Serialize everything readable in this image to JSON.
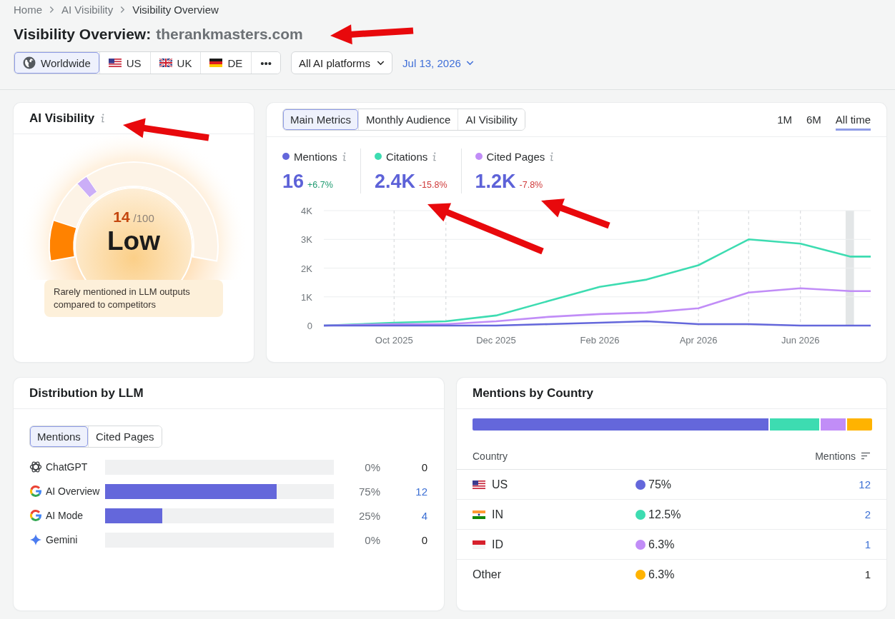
{
  "breadcrumb": [
    {
      "label": "Home",
      "current": false
    },
    {
      "label": "AI Visibility",
      "current": false
    },
    {
      "label": "Visibility Overview",
      "current": true
    }
  ],
  "page_title": {
    "heading": "Visibility Overview:",
    "domain": "therankmasters.com"
  },
  "filters": {
    "regions": [
      {
        "kind": "all",
        "label": "Worldwide",
        "selected": true
      },
      {
        "kind": "country",
        "label": "US",
        "selected": false
      },
      {
        "kind": "country",
        "label": "UK",
        "selected": false
      },
      {
        "kind": "country",
        "label": "DE",
        "selected": false
      },
      {
        "kind": "more",
        "label": "•••",
        "selected": false
      }
    ],
    "platform": "All AI platforms",
    "date": "Jul 13, 2026"
  },
  "visibility_card": {
    "title": "AI Visibility",
    "score": "14",
    "score_max": "/100",
    "rating": "Low",
    "level": 0.14,
    "benchmark": {
      "level": 0.31
    },
    "description": "Rarely mentioned in LLM outputs compared to competitors"
  },
  "metrics_panel": {
    "tabs": [
      {
        "label": "Main Metrics",
        "selected": true
      },
      {
        "label": "Monthly Audience",
        "selected": false
      },
      {
        "label": "AI Visibility",
        "selected": false
      }
    ],
    "ranges": [
      {
        "label": "1M",
        "selected": false
      },
      {
        "label": "6M",
        "selected": false
      },
      {
        "label": "All time",
        "selected": true
      }
    ],
    "metrics": [
      {
        "label": "Mentions",
        "color": "#6467db",
        "value": "16",
        "change": "+6.7%",
        "positive": true
      },
      {
        "label": "Citations",
        "color": "#3ddcb1",
        "value": "2.4K",
        "change": "-15.8%",
        "positive": false
      },
      {
        "label": "Cited Pages",
        "color": "#c18df7",
        "value": "1.2K",
        "change": "-7.8%",
        "positive": false
      }
    ],
    "chart_data": [
      {
        "type": "line",
        "x": [
          "2025-08-20",
          "2025-10-01",
          "2025-11-01",
          "2025-12-01",
          "2026-01-01",
          "2026-02-01",
          "2026-03-01",
          "2026-04-01",
          "2026-05-01",
          "2026-06-01",
          "2026-07-01",
          "2026-07-13"
        ],
        "series": [
          {
            "color": "#3ddcb1",
            "values": [
              0,
              100,
              150,
              350,
              850,
              1350,
              1600,
              2100,
              3000,
              2850,
              2400,
              2400
            ]
          },
          {
            "color": "#c18df7",
            "values": [
              0,
              50,
              50,
              150,
              300,
              400,
              450,
              600,
              1150,
              1300,
              1200,
              1200
            ]
          },
          {
            "color": "#6467db",
            "values": [
              0,
              0,
              0,
              0,
              50,
              100,
              150,
              50,
              50,
              0,
              0,
              0
            ]
          }
        ],
        "xlim": [
          "2025-08-20",
          "2026-07-13"
        ],
        "ylim": [
          0,
          4000
        ],
        "yticks": [
          {
            "value": 0,
            "label": "0"
          },
          {
            "value": 1000,
            "label": "1K"
          },
          {
            "value": 2000,
            "label": "2K"
          },
          {
            "value": 3000,
            "label": "3K"
          },
          {
            "value": 4000,
            "label": "4K"
          }
        ],
        "xticks": [
          {
            "value": "2025-10-01",
            "label": "Oct 2025"
          },
          {
            "value": "2025-12-01",
            "label": "Dec 2025"
          },
          {
            "value": "2026-02-01",
            "label": "Feb 2026"
          },
          {
            "value": "2026-04-01",
            "label": "Apr 2026"
          },
          {
            "value": "2026-06-01",
            "label": "Jun 2026"
          }
        ],
        "grid": true,
        "ref_lines": [
          {
            "axis": "x",
            "value": "2025-10-01",
            "color": "#d3d6d9",
            "line_style": "dashed"
          },
          {
            "axis": "x",
            "value": "2025-11-01",
            "color": "#d3d6d9",
            "line_style": "dashed"
          },
          {
            "axis": "x",
            "value": "2026-04-01",
            "color": "#d3d6d9",
            "line_style": "dashed"
          },
          {
            "axis": "x",
            "value": "2026-05-01",
            "color": "#d3d6d9",
            "line_style": "dashed"
          },
          {
            "axis": "x",
            "value": "2026-06-01",
            "color": "#d3d6d9",
            "line_style": "dashed"
          }
        ],
        "bands": [
          {
            "axis": "x",
            "from": "2026-06-28",
            "to": "2026-07-03",
            "color": "#e3e6e7"
          }
        ]
      }
    ]
  },
  "llm_distribution": {
    "title": "Distribution by LLM",
    "tabs": [
      {
        "label": "Mentions",
        "selected": true
      },
      {
        "label": "Cited Pages",
        "selected": false
      }
    ],
    "rows": [
      {
        "name": "ChatGPT",
        "level": 0,
        "share": "0%",
        "count": "0",
        "link": false
      },
      {
        "name": "AI Overview",
        "level": 0.75,
        "share": "75%",
        "count": "12",
        "link": true
      },
      {
        "name": "AI Mode",
        "level": 0.25,
        "share": "25%",
        "count": "4",
        "link": true
      },
      {
        "name": "Gemini",
        "level": 0,
        "share": "0%",
        "count": "0",
        "link": false
      }
    ]
  },
  "country_mentions": {
    "title": "Mentions by Country",
    "columns": [
      "Country",
      "Mentions"
    ],
    "rows": [
      {
        "kind": "country",
        "name": "US",
        "color": "#6467db",
        "share": "75%",
        "count": "12",
        "link": true
      },
      {
        "kind": "country",
        "name": "IN",
        "color": "#3ddcb1",
        "share": "12.5%",
        "count": "2",
        "link": true
      },
      {
        "kind": "country",
        "name": "ID",
        "color": "#c18df7",
        "share": "6.3%",
        "count": "1",
        "link": true
      },
      {
        "kind": "other",
        "name": "Other",
        "color": "#ffb300",
        "share": "6.3%",
        "count": "1",
        "link": false
      }
    ]
  }
}
